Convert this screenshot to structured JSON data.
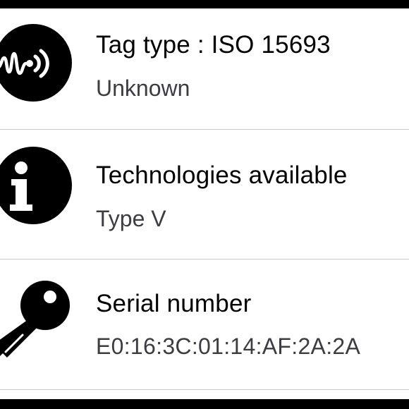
{
  "rows": [
    {
      "title": "Tag type : ISO 15693",
      "subtitle": "Unknown",
      "icon": "nfc-tag-icon"
    },
    {
      "title": "Technologies available",
      "subtitle": "Type V",
      "icon": "info-icon"
    },
    {
      "title": "Serial number",
      "subtitle": "E0:16:3C:01:14:AF:2A:2A",
      "icon": "key-icon"
    }
  ],
  "colors": {
    "background": "#ffffff",
    "frame": "#000000",
    "divider": "#c8c7cc",
    "title_text": "#000000",
    "subtitle_text": "#3c3c43"
  }
}
